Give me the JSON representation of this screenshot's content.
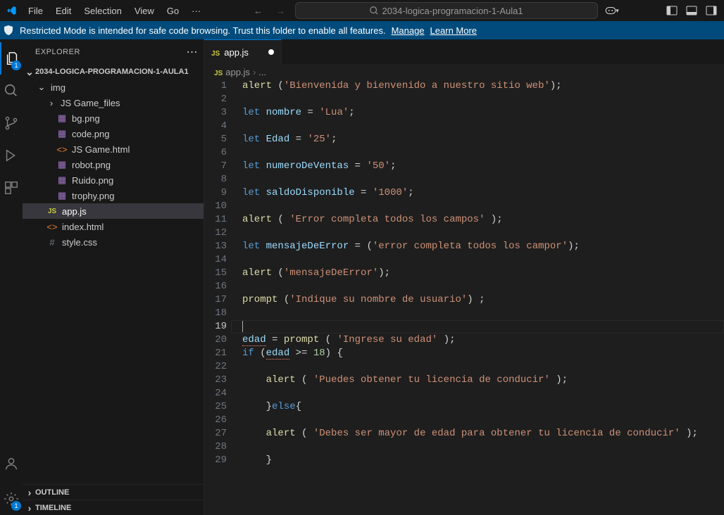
{
  "menu": {
    "file": "File",
    "edit": "Edit",
    "selection": "Selection",
    "view": "View",
    "go": "Go",
    "more": "···"
  },
  "titlebar": {
    "project": "2034-logica-programacion-1-Aula1"
  },
  "infobar": {
    "message": "Restricted Mode is intended for safe code browsing. Trust this folder to enable all features.",
    "manage": "Manage",
    "learn": "Learn More"
  },
  "sidebar": {
    "title": "EXPLORER",
    "root": "2034-LOGICA-PROGRAMACION-1-AULA1",
    "folder_img": "img",
    "folder_jsgamefiles": "JS Game_files",
    "files": {
      "bgpng": "bg.png",
      "codepng": "code.png",
      "jsgamehtml": "JS Game.html",
      "robotpng": "robot.png",
      "ruidopng": "Ruido.png",
      "trophypng": "trophy.png",
      "appjs": "app.js",
      "indexhtml": "index.html",
      "stylecss": "style.css"
    },
    "outline": "OUTLINE",
    "timeline": "TIMELINE"
  },
  "activity": {
    "explorer_badge": "1",
    "settings_badge": "1"
  },
  "tab": {
    "appjs": "app.js"
  },
  "breadcrumb": {
    "file": "app.js",
    "more": "..."
  },
  "code": {
    "l1_a": "alert",
    "l1_b": " (",
    "l1_c": "'Bienvenida y bienvenido a nuestro sitio web'",
    "l1_d": ");",
    "l3_a": "let",
    "l3_b": " nombre",
    "l3_c": " = ",
    "l3_d": "'Lua'",
    "l3_e": ";",
    "l5_a": "let",
    "l5_b": " Edad",
    "l5_c": " = ",
    "l5_d": "'25'",
    "l5_e": ";",
    "l7_a": "let",
    "l7_b": " numeroDeVentas",
    "l7_c": " = ",
    "l7_d": "'50'",
    "l7_e": ";",
    "l9_a": "let",
    "l9_b": " saldoDisponible",
    "l9_c": " = ",
    "l9_d": "'1000'",
    "l9_e": ";",
    "l11_a": "alert",
    "l11_b": " ( ",
    "l11_c": "'Error completa todos los campos'",
    "l11_d": " );",
    "l13_a": "let",
    "l13_b": " mensajeDeError",
    "l13_c": " = (",
    "l13_d": "'error completa todos los campor'",
    "l13_e": ");",
    "l15_a": "alert",
    "l15_b": " (",
    "l15_c": "'mensajeDeError'",
    "l15_d": ");",
    "l17_a": "prompt",
    "l17_b": " (",
    "l17_c": "'Indique su nombre de usuario'",
    "l17_d": ") ;",
    "l20_a": "edad",
    "l20_b": " = ",
    "l20_c": "prompt",
    "l20_d": " ( ",
    "l20_e": "'Ingrese su edad'",
    "l20_f": " );",
    "l21_a": "if",
    "l21_b": " (",
    "l21_c": "edad",
    "l21_d": " >= ",
    "l21_e": "18",
    "l21_f": ") {",
    "l23_a": "    ",
    "l23_b": "alert",
    "l23_c": " ( ",
    "l23_d": "'Puedes obtener tu licencia de conducir'",
    "l23_e": " );",
    "l25_a": "    }",
    "l25_b": "else",
    "l25_c": "{",
    "l27_a": "    ",
    "l27_b": "alert",
    "l27_c": " ( ",
    "l27_d": "'Debes ser mayor de edad para obtener tu licencia de conducir'",
    "l27_e": " );",
    "l29_a": "    }"
  },
  "lineNumbers": [
    "1",
    "2",
    "3",
    "4",
    "5",
    "6",
    "7",
    "8",
    "9",
    "10",
    "11",
    "12",
    "13",
    "14",
    "15",
    "16",
    "17",
    "18",
    "19",
    "20",
    "21",
    "22",
    "23",
    "24",
    "25",
    "26",
    "27",
    "28",
    "29"
  ],
  "currentLine": 19
}
